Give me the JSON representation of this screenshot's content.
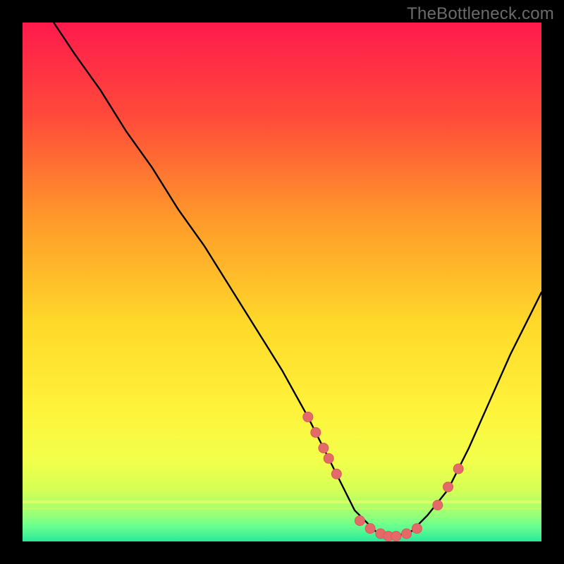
{
  "watermark": "TheBottleneck.com",
  "colors": {
    "background": "#000000",
    "gradient_top": "#ff1a4d",
    "gradient_mid1": "#ff8a2a",
    "gradient_mid2": "#ffe92e",
    "gradient_low": "#d9ff3a",
    "gradient_bottom": "#2bffa0",
    "curve": "#000000",
    "marker_fill": "#e46a6a",
    "marker_stroke": "#d85a5a"
  },
  "chart_data": {
    "type": "line",
    "title": "",
    "xlabel": "",
    "ylabel": "",
    "xlim": [
      0,
      100
    ],
    "ylim": [
      0,
      100
    ],
    "series": [
      {
        "name": "bottleneck-curve",
        "x": [
          6,
          10,
          15,
          20,
          25,
          30,
          35,
          40,
          45,
          50,
          55,
          58,
          60,
          62,
          64,
          66,
          68,
          70,
          72,
          75,
          78,
          82,
          86,
          90,
          94,
          98,
          100
        ],
        "y": [
          100,
          94,
          87,
          79,
          72,
          64,
          57,
          49,
          41,
          33,
          24,
          18,
          14,
          10,
          6,
          4,
          2,
          1,
          1,
          2,
          5,
          10,
          18,
          27,
          36,
          44,
          48
        ]
      }
    ],
    "markers": {
      "name": "highlight-points",
      "x": [
        55,
        56.5,
        58,
        59,
        60.5,
        65,
        67,
        69,
        70.5,
        72,
        74,
        76,
        80,
        82,
        84
      ],
      "y": [
        24,
        21,
        18,
        16,
        13,
        4,
        2.5,
        1.5,
        1,
        1,
        1.5,
        2.5,
        7,
        10.5,
        14
      ]
    }
  }
}
